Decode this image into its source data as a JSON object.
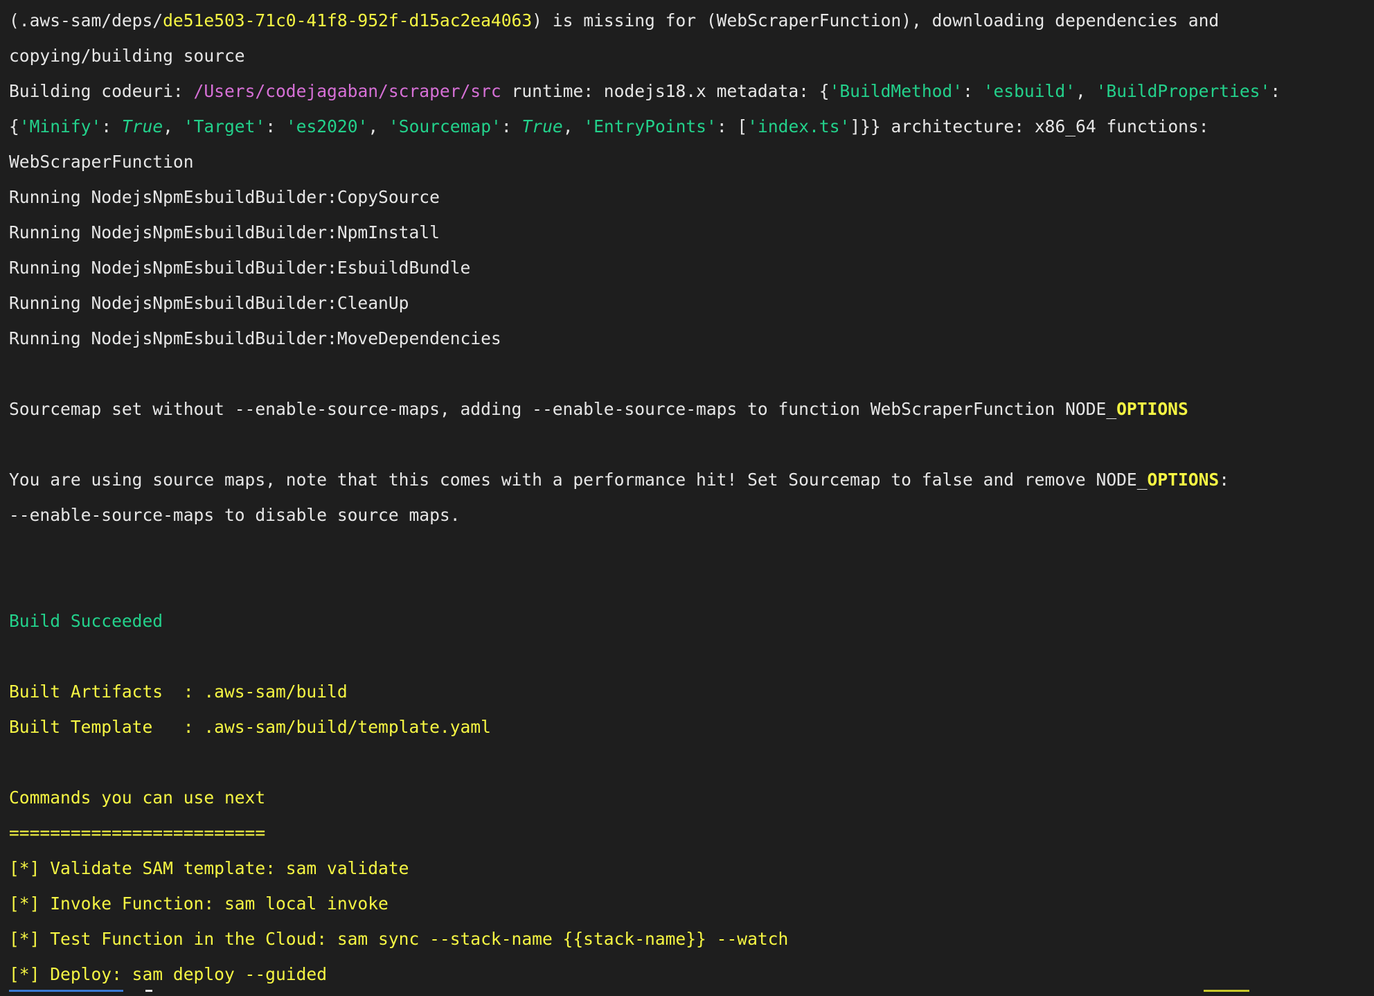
{
  "colors": {
    "background": "#1e1e1e",
    "text": "#e6e6e6",
    "yellow": "#f5f543",
    "green": "#23d18b",
    "magenta": "#d670d6"
  },
  "lines": {
    "l1": {
      "a": "(.aws-sam/deps/",
      "b": "de51e503-71c0-41f8-952f-d15ac2ea4063",
      "c": ") is missing for (WebScraperFunction), downloading dependencies and"
    },
    "l2": "copying/building source",
    "l3": {
      "a": "Building codeuri: ",
      "b": "/Users/codejagaban/scraper/src",
      "c": " runtime: nodejs18.x metadata: {",
      "d": "'BuildMethod'",
      "e": ": ",
      "f": "'esbuild'",
      "g": ", ",
      "h": "'BuildProperties'",
      "i": ":"
    },
    "l4": {
      "a": "{",
      "b": "'Minify'",
      "c": ": ",
      "d": "True",
      "e": ", ",
      "f": "'Target'",
      "g": ": ",
      "h": "'es2020'",
      "i": ", ",
      "j": "'Sourcemap'",
      "k": ": ",
      "l": "True",
      "m": ", ",
      "n": "'EntryPoints'",
      "o": ": [",
      "p": "'index.ts'",
      "q": "]}} architecture: x86_64 functions:"
    },
    "l5": "WebScraperFunction",
    "l6": "Running NodejsNpmEsbuildBuilder:CopySource",
    "l7": "Running NodejsNpmEsbuildBuilder:NpmInstall",
    "l8": "Running NodejsNpmEsbuildBuilder:EsbuildBundle",
    "l9": "Running NodejsNpmEsbuildBuilder:CleanUp",
    "l10": "Running NodejsNpmEsbuildBuilder:MoveDependencies",
    "l11": {
      "a": "Sourcemap set without --enable-source-maps, adding --enable-source-maps to function WebScraperFunction NODE_",
      "b": "OPTIONS"
    },
    "l12": {
      "a": "You are using source maps, note that this comes with a performance hit! Set Sourcemap to false and remove NODE_",
      "b": "OPTIONS",
      "c": ":"
    },
    "l13": "--enable-source-maps to disable source maps.",
    "l14": "Build Succeeded",
    "l15": "Built Artifacts  : .aws-sam/build",
    "l16": "Built Template   : .aws-sam/build/template.yaml",
    "l17": "Commands you can use next",
    "l18": "=========================",
    "l19": "[*] Validate SAM template: sam validate",
    "l20": "[*] Invoke Function: sam local invoke",
    "l21": "[*] Test Function in the Cloud: sam sync --stack-name {{stack-name}} --watch",
    "l22": "[*] Deploy: sam deploy --guided"
  }
}
